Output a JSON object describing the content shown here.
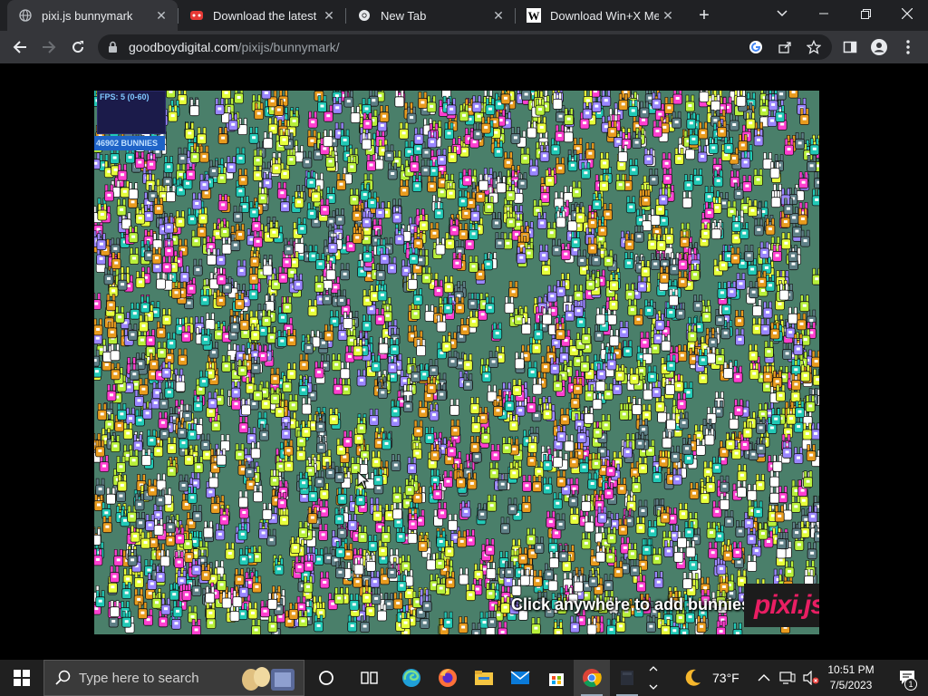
{
  "browser": {
    "tabs": [
      {
        "title": "pixi.js bunnymark",
        "icon": "globe-icon",
        "active": true
      },
      {
        "title": "Download the latest ind",
        "icon": "gamepad-icon",
        "active": false
      },
      {
        "title": "New Tab",
        "icon": "chrome-icon",
        "active": false
      },
      {
        "title": "Download Win+X Men",
        "icon": "wordpress-w-icon",
        "active": false
      }
    ],
    "new_tab_label": "+",
    "url_domain": "goodboydigital.com",
    "url_path": "/pixijs/bunnymark/"
  },
  "page": {
    "fps_label": "FPS: 5 (0-60)",
    "bunny_count": "46902 BUNNIES",
    "hint": "Click anywhere to add bunnies!",
    "logo_text": "pixi.js"
  },
  "taskbar": {
    "search_placeholder": "Type here to search",
    "weather_temp": "73°F",
    "time": "10:51 PM",
    "date": "7/5/2023",
    "notification_count": "1"
  },
  "colors": {
    "bunny_palette": [
      "#e6ff3a",
      "#22c9b6",
      "#e89b1e",
      "#9a86ff",
      "#ff3fd0",
      "#ffffff",
      "#5e7f86",
      "#b8f03a"
    ]
  }
}
